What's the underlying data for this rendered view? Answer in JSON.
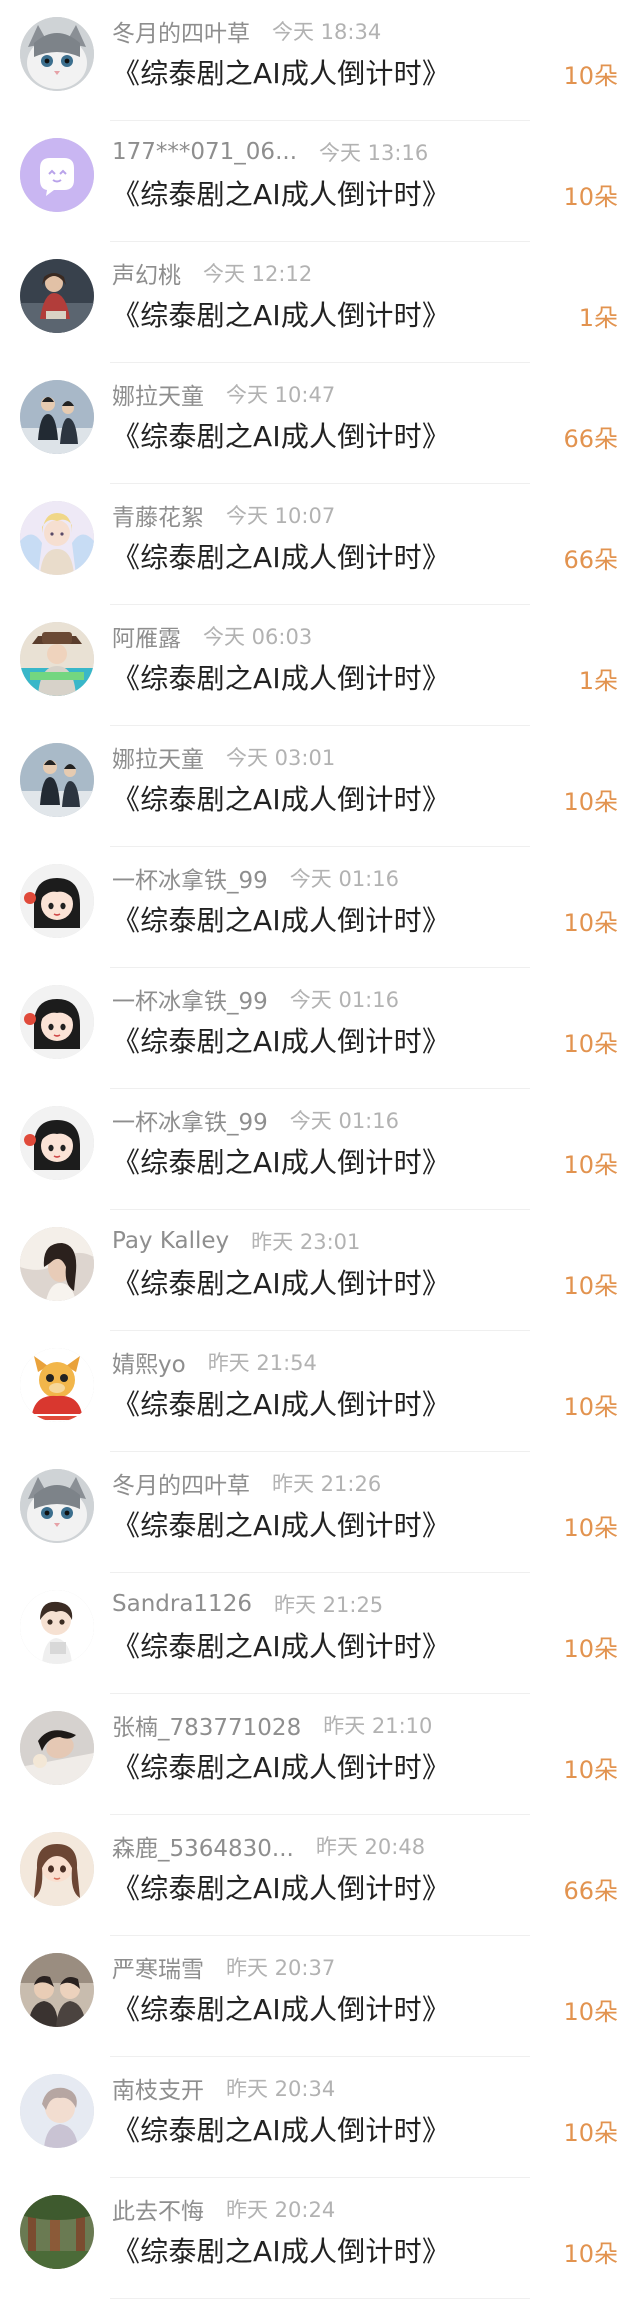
{
  "accent_color": "#e2934f",
  "rows": [
    {
      "name": "冬月的四叶草",
      "time": "今天 18:34",
      "title": "《综泰剧之AI成人倒计时》",
      "gift": "10朵",
      "avatar": "cat-avatar"
    },
    {
      "name": "177***071_06...",
      "time": "今天 13:16",
      "title": "《综泰剧之AI成人倒计时》",
      "gift": "10朵",
      "avatar": "default-avatar"
    },
    {
      "name": "声幻桃",
      "time": "今天 12:12",
      "title": "《综泰剧之AI成人倒计时》",
      "gift": "1朵",
      "avatar": "photo-avatar"
    },
    {
      "name": "娜拉天童",
      "time": "今天 10:47",
      "title": "《综泰剧之AI成人倒计时》",
      "gift": "66朵",
      "avatar": "photo-avatar"
    },
    {
      "name": "青藤花絮",
      "time": "今天 10:07",
      "title": "《综泰剧之AI成人倒计时》",
      "gift": "66朵",
      "avatar": "illustration-avatar"
    },
    {
      "name": "阿雁露",
      "time": "今天 06:03",
      "title": "《综泰剧之AI成人倒计时》",
      "gift": "1朵",
      "avatar": "photo-avatar"
    },
    {
      "name": "娜拉天童",
      "time": "今天 03:01",
      "title": "《综泰剧之AI成人倒计时》",
      "gift": "10朵",
      "avatar": "photo-avatar"
    },
    {
      "name": "一杯冰拿铁_99",
      "time": "今天 01:16",
      "title": "《综泰剧之AI成人倒计时》",
      "gift": "10朵",
      "avatar": "cartoon-girl-avatar"
    },
    {
      "name": "一杯冰拿铁_99",
      "time": "今天 01:16",
      "title": "《综泰剧之AI成人倒计时》",
      "gift": "10朵",
      "avatar": "cartoon-girl-avatar"
    },
    {
      "name": "一杯冰拿铁_99",
      "time": "今天 01:16",
      "title": "《综泰剧之AI成人倒计时》",
      "gift": "10朵",
      "avatar": "cartoon-girl-avatar"
    },
    {
      "name": "Pay Kalley",
      "time": "昨天 23:01",
      "title": "《综泰剧之AI成人倒计时》",
      "gift": "10朵",
      "avatar": "photo-avatar"
    },
    {
      "name": "婧熙yo",
      "time": "昨天 21:54",
      "title": "《综泰剧之AI成人倒计时》",
      "gift": "10朵",
      "avatar": "dragon-avatar"
    },
    {
      "name": "冬月的四叶草",
      "time": "昨天 21:26",
      "title": "《综泰剧之AI成人倒计时》",
      "gift": "10朵",
      "avatar": "cat-avatar"
    },
    {
      "name": "Sandra1126",
      "time": "昨天 21:25",
      "title": "《综泰剧之AI成人倒计时》",
      "gift": "10朵",
      "avatar": "chibi-avatar"
    },
    {
      "name": "张楠_783771028",
      "time": "昨天 21:10",
      "title": "《综泰剧之AI成人倒计时》",
      "gift": "10朵",
      "avatar": "photo-avatar"
    },
    {
      "name": "森鹿_5364830...",
      "time": "昨天 20:48",
      "title": "《综泰剧之AI成人倒计时》",
      "gift": "66朵",
      "avatar": "illustration-avatar"
    },
    {
      "name": "严寒瑞雪",
      "time": "昨天 20:37",
      "title": "《综泰剧之AI成人倒计时》",
      "gift": "10朵",
      "avatar": "photo-avatar"
    },
    {
      "name": "南枝支开",
      "time": "昨天 20:34",
      "title": "《综泰剧之AI成人倒计时》",
      "gift": "10朵",
      "avatar": "photo-avatar"
    },
    {
      "name": "此去不悔",
      "time": "昨天 20:24",
      "title": "《综泰剧之AI成人倒计时》",
      "gift": "10朵",
      "avatar": "photo-avatar"
    }
  ]
}
